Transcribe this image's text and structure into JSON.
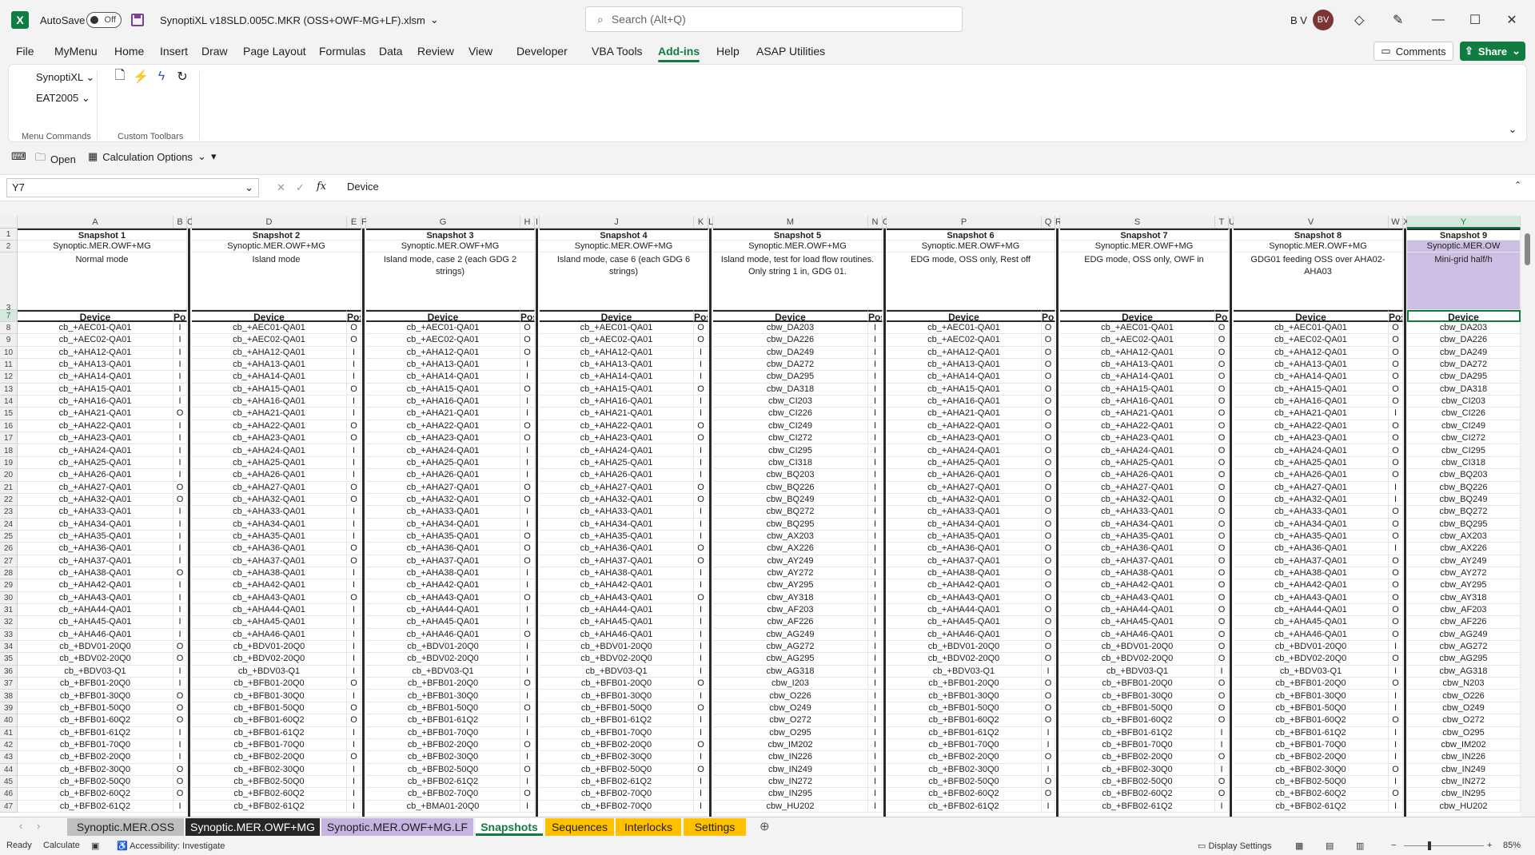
{
  "titlebar": {
    "autosave_label": "AutoSave",
    "autosave_state": "Off",
    "filename": "SynoptiXL v18SLD.005C.MKR (OSS+OWF-MG+LF).xlsm",
    "search_placeholder": "Search (Alt+Q)",
    "user_initials": "B V",
    "avatar_initials": "BV"
  },
  "ribbon_tabs": [
    "File",
    "MyMenu",
    "Home",
    "Insert",
    "Draw",
    "Page Layout",
    "Formulas",
    "Data",
    "Review",
    "View",
    "Developer",
    "VBA Tools",
    "Add-ins",
    "Help",
    "ASAP Utilities"
  ],
  "active_tab": "Add-ins",
  "actions": {
    "comments": "Comments",
    "share": "Share"
  },
  "ribbon": {
    "menu_commands": [
      "SynoptiXL",
      "EAT2005"
    ],
    "group_menu_label": "Menu Commands",
    "group_toolbar_label": "Custom Toolbars"
  },
  "qat": {
    "open": "Open",
    "calc_options": "Calculation Options"
  },
  "formula_bar": {
    "name_box": "Y7",
    "fx": "fx",
    "content": "Device"
  },
  "column_letters": [
    "A",
    "B",
    "C",
    "D",
    "E",
    "F",
    "G",
    "H",
    "I",
    "J",
    "K",
    "L",
    "M",
    "N",
    "O",
    "P",
    "Q",
    "R",
    "S",
    "T",
    "U",
    "V",
    "W",
    "X",
    "Y"
  ],
  "row_numbers": [
    "1",
    "2",
    "3",
    "7",
    "8",
    "9",
    "10",
    "11",
    "12",
    "13",
    "14",
    "15",
    "16",
    "17",
    "18",
    "19",
    "20",
    "21",
    "22",
    "23",
    "24",
    "25",
    "26",
    "27",
    "28",
    "29",
    "30",
    "31",
    "32",
    "33",
    "34",
    "35",
    "36",
    "37",
    "38",
    "39",
    "40",
    "41",
    "42",
    "43",
    "44",
    "45",
    "46",
    "47"
  ],
  "col_header_device": "Device",
  "col_header_pos": "Pos",
  "snapshots": [
    {
      "title": "Snapshot 1",
      "source": "Synoptic.MER.OWF+MG",
      "desc": "Normal mode",
      "devices": [
        "cb_+AEC01-QA01",
        "cb_+AEC02-QA01",
        "cb_+AHA12-QA01",
        "cb_+AHA13-QA01",
        "cb_+AHA14-QA01",
        "cb_+AHA15-QA01",
        "cb_+AHA16-QA01",
        "cb_+AHA21-QA01",
        "cb_+AHA22-QA01",
        "cb_+AHA23-QA01",
        "cb_+AHA24-QA01",
        "cb_+AHA25-QA01",
        "cb_+AHA26-QA01",
        "cb_+AHA27-QA01",
        "cb_+AHA32-QA01",
        "cb_+AHA33-QA01",
        "cb_+AHA34-QA01",
        "cb_+AHA35-QA01",
        "cb_+AHA36-QA01",
        "cb_+AHA37-QA01",
        "cb_+AHA38-QA01",
        "cb_+AHA42-QA01",
        "cb_+AHA43-QA01",
        "cb_+AHA44-QA01",
        "cb_+AHA45-QA01",
        "cb_+AHA46-QA01",
        "cb_+BDV01-20Q0",
        "cb_+BDV02-20Q0",
        "cb_+BDV03-Q1",
        "cb_+BFB01-20Q0",
        "cb_+BFB01-30Q0",
        "cb_+BFB01-50Q0",
        "cb_+BFB01-60Q2",
        "cb_+BFB01-61Q2",
        "cb_+BFB01-70Q0",
        "cb_+BFB02-20Q0",
        "cb_+BFB02-30Q0",
        "cb_+BFB02-50Q0",
        "cb_+BFB02-60Q2",
        "cb_+BFB02-61Q2"
      ],
      "pos": [
        "I",
        "I",
        "I",
        "I",
        "I",
        "I",
        "I",
        "O",
        "I",
        "I",
        "I",
        "I",
        "I",
        "O",
        "O",
        "I",
        "I",
        "I",
        "I",
        "I",
        "O",
        "I",
        "I",
        "I",
        "I",
        "I",
        "O",
        "O",
        "I",
        "I",
        "O",
        "O",
        "O",
        "I",
        "I",
        "I",
        "O",
        "O",
        "O",
        "I"
      ]
    },
    {
      "title": "Snapshot 2",
      "source": "Synoptic.MER.OWF+MG",
      "desc": "Island mode",
      "devices": [
        "cb_+AEC01-QA01",
        "cb_+AEC02-QA01",
        "cb_+AHA12-QA01",
        "cb_+AHA13-QA01",
        "cb_+AHA14-QA01",
        "cb_+AHA15-QA01",
        "cb_+AHA16-QA01",
        "cb_+AHA21-QA01",
        "cb_+AHA22-QA01",
        "cb_+AHA23-QA01",
        "cb_+AHA24-QA01",
        "cb_+AHA25-QA01",
        "cb_+AHA26-QA01",
        "cb_+AHA27-QA01",
        "cb_+AHA32-QA01",
        "cb_+AHA33-QA01",
        "cb_+AHA34-QA01",
        "cb_+AHA35-QA01",
        "cb_+AHA36-QA01",
        "cb_+AHA37-QA01",
        "cb_+AHA38-QA01",
        "cb_+AHA42-QA01",
        "cb_+AHA43-QA01",
        "cb_+AHA44-QA01",
        "cb_+AHA45-QA01",
        "cb_+AHA46-QA01",
        "cb_+BDV01-20Q0",
        "cb_+BDV02-20Q0",
        "cb_+BDV03-Q1",
        "cb_+BFB01-20Q0",
        "cb_+BFB01-30Q0",
        "cb_+BFB01-50Q0",
        "cb_+BFB01-60Q2",
        "cb_+BFB01-61Q2",
        "cb_+BFB01-70Q0",
        "cb_+BFB02-20Q0",
        "cb_+BFB02-30Q0",
        "cb_+BFB02-50Q0",
        "cb_+BFB02-60Q2",
        "cb_+BFB02-61Q2"
      ],
      "pos": [
        "O",
        "O",
        "I",
        "I",
        "I",
        "O",
        "I",
        "I",
        "O",
        "O",
        "I",
        "I",
        "I",
        "O",
        "O",
        "I",
        "I",
        "I",
        "O",
        "O",
        "I",
        "I",
        "O",
        "I",
        "I",
        "I",
        "I",
        "I",
        "I",
        "O",
        "I",
        "O",
        "O",
        "I",
        "I",
        "O",
        "I",
        "I",
        "I",
        "I"
      ]
    },
    {
      "title": "Snapshot 3",
      "source": "Synoptic.MER.OWF+MG",
      "desc": "Island mode, case 2 (each GDG 2 strings)",
      "devices": [
        "cb_+AEC01-QA01",
        "cb_+AEC02-QA01",
        "cb_+AHA12-QA01",
        "cb_+AHA13-QA01",
        "cb_+AHA14-QA01",
        "cb_+AHA15-QA01",
        "cb_+AHA16-QA01",
        "cb_+AHA21-QA01",
        "cb_+AHA22-QA01",
        "cb_+AHA23-QA01",
        "cb_+AHA24-QA01",
        "cb_+AHA25-QA01",
        "cb_+AHA26-QA01",
        "cb_+AHA27-QA01",
        "cb_+AHA32-QA01",
        "cb_+AHA33-QA01",
        "cb_+AHA34-QA01",
        "cb_+AHA35-QA01",
        "cb_+AHA36-QA01",
        "cb_+AHA37-QA01",
        "cb_+AHA38-QA01",
        "cb_+AHA42-QA01",
        "cb_+AHA43-QA01",
        "cb_+AHA44-QA01",
        "cb_+AHA45-QA01",
        "cb_+AHA46-QA01",
        "cb_+BDV01-20Q0",
        "cb_+BDV02-20Q0",
        "cb_+BDV03-Q1",
        "cb_+BFB01-20Q0",
        "cb_+BFB01-30Q0",
        "cb_+BFB01-50Q0",
        "cb_+BFB01-61Q2",
        "cb_+BFB01-70Q0",
        "cb_+BFB02-20Q0",
        "cb_+BFB02-30Q0",
        "cb_+BFB02-50Q0",
        "cb_+BFB02-61Q2",
        "cb_+BFB02-70Q0",
        "cb_+BMA01-20Q0"
      ],
      "pos": [
        "O",
        "O",
        "O",
        "I",
        "I",
        "O",
        "I",
        "I",
        "O",
        "O",
        "I",
        "I",
        "I",
        "O",
        "O",
        "I",
        "I",
        "O",
        "O",
        "O",
        "I",
        "I",
        "O",
        "I",
        "I",
        "O",
        "I",
        "I",
        "I",
        "O",
        "I",
        "O",
        "I",
        "I",
        "O",
        "I",
        "O",
        "I",
        "O",
        "I"
      ]
    },
    {
      "title": "Snapshot 4",
      "source": "Synoptic.MER.OWF+MG",
      "desc": "Island mode, case 6 (each GDG 6 strings)",
      "devices": [
        "cb_+AEC01-QA01",
        "cb_+AEC02-QA01",
        "cb_+AHA12-QA01",
        "cb_+AHA13-QA01",
        "cb_+AHA14-QA01",
        "cb_+AHA15-QA01",
        "cb_+AHA16-QA01",
        "cb_+AHA21-QA01",
        "cb_+AHA22-QA01",
        "cb_+AHA23-QA01",
        "cb_+AHA24-QA01",
        "cb_+AHA25-QA01",
        "cb_+AHA26-QA01",
        "cb_+AHA27-QA01",
        "cb_+AHA32-QA01",
        "cb_+AHA33-QA01",
        "cb_+AHA34-QA01",
        "cb_+AHA35-QA01",
        "cb_+AHA36-QA01",
        "cb_+AHA37-QA01",
        "cb_+AHA38-QA01",
        "cb_+AHA42-QA01",
        "cb_+AHA43-QA01",
        "cb_+AHA44-QA01",
        "cb_+AHA45-QA01",
        "cb_+AHA46-QA01",
        "cb_+BDV01-20Q0",
        "cb_+BDV02-20Q0",
        "cb_+BDV03-Q1",
        "cb_+BFB01-20Q0",
        "cb_+BFB01-30Q0",
        "cb_+BFB01-50Q0",
        "cb_+BFB01-61Q2",
        "cb_+BFB01-70Q0",
        "cb_+BFB02-20Q0",
        "cb_+BFB02-30Q0",
        "cb_+BFB02-50Q0",
        "cb_+BFB02-61Q2",
        "cb_+BFB02-70Q0",
        "cb_+BFB02-70Q0"
      ],
      "pos": [
        "O",
        "O",
        "I",
        "I",
        "I",
        "O",
        "I",
        "I",
        "O",
        "O",
        "I",
        "I",
        "I",
        "O",
        "O",
        "I",
        "I",
        "I",
        "O",
        "O",
        "I",
        "I",
        "O",
        "I",
        "I",
        "I",
        "I",
        "I",
        "I",
        "O",
        "I",
        "O",
        "I",
        "I",
        "O",
        "I",
        "O",
        "I",
        "I",
        "I"
      ]
    },
    {
      "title": "Snapshot 5",
      "source": "Synoptic.MER.OWF+MG",
      "desc": "Island mode, test for load flow routines. Only string 1 in, GDG 01.",
      "devices": [
        "cbw_DA203",
        "cbw_DA226",
        "cbw_DA249",
        "cbw_DA272",
        "cbw_DA295",
        "cbw_DA318",
        "cbw_CI203",
        "cbw_CI226",
        "cbw_CI249",
        "cbw_CI272",
        "cbw_CI295",
        "cbw_CI318",
        "cbw_BQ203",
        "cbw_BQ226",
        "cbw_BQ249",
        "cbw_BQ272",
        "cbw_BQ295",
        "cbw_AX203",
        "cbw_AX226",
        "cbw_AY249",
        "cbw_AY272",
        "cbw_AY295",
        "cbw_AY318",
        "cbw_AF203",
        "cbw_AF226",
        "cbw_AG249",
        "cbw_AG272",
        "cbw_AG295",
        "cbw_AG318",
        "cbw_I203",
        "cbw_O226",
        "cbw_O249",
        "cbw_O272",
        "cbw_O295",
        "cbw_IM202",
        "cbw_IN226",
        "cbw_IN249",
        "cbw_IN272",
        "cbw_IN295",
        "cbw_HU202"
      ],
      "pos": [
        "I",
        "I",
        "I",
        "I",
        "I",
        "I",
        "I",
        "I",
        "I",
        "I",
        "I",
        "I",
        "I",
        "I",
        "I",
        "I",
        "I",
        "I",
        "I",
        "I",
        "I",
        "I",
        "I",
        "I",
        "I",
        "I",
        "I",
        "I",
        "I",
        "I",
        "I",
        "I",
        "I",
        "I",
        "I",
        "I",
        "I",
        "I",
        "I",
        "I"
      ]
    },
    {
      "title": "Snapshot 6",
      "source": "Synoptic.MER.OWF+MG",
      "desc": "EDG mode, OSS only, Rest off",
      "devices": [
        "cb_+AEC01-QA01",
        "cb_+AEC02-QA01",
        "cb_+AHA12-QA01",
        "cb_+AHA13-QA01",
        "cb_+AHA14-QA01",
        "cb_+AHA15-QA01",
        "cb_+AHA16-QA01",
        "cb_+AHA21-QA01",
        "cb_+AHA22-QA01",
        "cb_+AHA23-QA01",
        "cb_+AHA24-QA01",
        "cb_+AHA25-QA01",
        "cb_+AHA26-QA01",
        "cb_+AHA27-QA01",
        "cb_+AHA32-QA01",
        "cb_+AHA33-QA01",
        "cb_+AHA34-QA01",
        "cb_+AHA35-QA01",
        "cb_+AHA36-QA01",
        "cb_+AHA37-QA01",
        "cb_+AHA38-QA01",
        "cb_+AHA42-QA01",
        "cb_+AHA43-QA01",
        "cb_+AHA44-QA01",
        "cb_+AHA45-QA01",
        "cb_+AHA46-QA01",
        "cb_+BDV01-20Q0",
        "cb_+BDV02-20Q0",
        "cb_+BDV03-Q1",
        "cb_+BFB01-20Q0",
        "cb_+BFB01-30Q0",
        "cb_+BFB01-50Q0",
        "cb_+BFB01-60Q2",
        "cb_+BFB01-61Q2",
        "cb_+BFB01-70Q0",
        "cb_+BFB02-20Q0",
        "cb_+BFB02-30Q0",
        "cb_+BFB02-50Q0",
        "cb_+BFB02-60Q2",
        "cb_+BFB02-61Q2"
      ],
      "pos": [
        "O",
        "O",
        "O",
        "O",
        "O",
        "O",
        "O",
        "O",
        "O",
        "O",
        "O",
        "O",
        "O",
        "O",
        "O",
        "O",
        "O",
        "O",
        "O",
        "O",
        "O",
        "O",
        "O",
        "O",
        "O",
        "O",
        "O",
        "O",
        "I",
        "O",
        "O",
        "O",
        "O",
        "I",
        "I",
        "O",
        "I",
        "O",
        "O",
        "I"
      ]
    },
    {
      "title": "Snapshot 7",
      "source": "Synoptic.MER.OWF+MG",
      "desc": "EDG mode, OSS only, OWF in",
      "devices": [
        "cb_+AEC01-QA01",
        "cb_+AEC02-QA01",
        "cb_+AHA12-QA01",
        "cb_+AHA13-QA01",
        "cb_+AHA14-QA01",
        "cb_+AHA15-QA01",
        "cb_+AHA16-QA01",
        "cb_+AHA21-QA01",
        "cb_+AHA22-QA01",
        "cb_+AHA23-QA01",
        "cb_+AHA24-QA01",
        "cb_+AHA25-QA01",
        "cb_+AHA26-QA01",
        "cb_+AHA27-QA01",
        "cb_+AHA32-QA01",
        "cb_+AHA33-QA01",
        "cb_+AHA34-QA01",
        "cb_+AHA35-QA01",
        "cb_+AHA36-QA01",
        "cb_+AHA37-QA01",
        "cb_+AHA38-QA01",
        "cb_+AHA42-QA01",
        "cb_+AHA43-QA01",
        "cb_+AHA44-QA01",
        "cb_+AHA45-QA01",
        "cb_+AHA46-QA01",
        "cb_+BDV01-20Q0",
        "cb_+BDV02-20Q0",
        "cb_+BDV03-Q1",
        "cb_+BFB01-20Q0",
        "cb_+BFB01-30Q0",
        "cb_+BFB01-50Q0",
        "cb_+BFB01-60Q2",
        "cb_+BFB01-61Q2",
        "cb_+BFB01-70Q0",
        "cb_+BFB02-20Q0",
        "cb_+BFB02-30Q0",
        "cb_+BFB02-50Q0",
        "cb_+BFB02-60Q2",
        "cb_+BFB02-61Q2"
      ],
      "pos": [
        "O",
        "O",
        "O",
        "O",
        "O",
        "O",
        "O",
        "O",
        "O",
        "O",
        "O",
        "O",
        "O",
        "O",
        "O",
        "O",
        "O",
        "O",
        "O",
        "O",
        "O",
        "O",
        "O",
        "O",
        "O",
        "O",
        "O",
        "O",
        "I",
        "O",
        "O",
        "O",
        "O",
        "I",
        "I",
        "O",
        "I",
        "O",
        "O",
        "I"
      ]
    },
    {
      "title": "Snapshot 8",
      "source": "Synoptic.MER.OWF+MG",
      "desc": "GDG01 feeding OSS over AHA02-AHA03",
      "devices": [
        "cb_+AEC01-QA01",
        "cb_+AEC02-QA01",
        "cb_+AHA12-QA01",
        "cb_+AHA13-QA01",
        "cb_+AHA14-QA01",
        "cb_+AHA15-QA01",
        "cb_+AHA16-QA01",
        "cb_+AHA21-QA01",
        "cb_+AHA22-QA01",
        "cb_+AHA23-QA01",
        "cb_+AHA24-QA01",
        "cb_+AHA25-QA01",
        "cb_+AHA26-QA01",
        "cb_+AHA27-QA01",
        "cb_+AHA32-QA01",
        "cb_+AHA33-QA01",
        "cb_+AHA34-QA01",
        "cb_+AHA35-QA01",
        "cb_+AHA36-QA01",
        "cb_+AHA37-QA01",
        "cb_+AHA38-QA01",
        "cb_+AHA42-QA01",
        "cb_+AHA43-QA01",
        "cb_+AHA44-QA01",
        "cb_+AHA45-QA01",
        "cb_+AHA46-QA01",
        "cb_+BDV01-20Q0",
        "cb_+BDV02-20Q0",
        "cb_+BDV03-Q1",
        "cb_+BFB01-20Q0",
        "cb_+BFB01-30Q0",
        "cb_+BFB01-50Q0",
        "cb_+BFB01-60Q2",
        "cb_+BFB01-61Q2",
        "cb_+BFB01-70Q0",
        "cb_+BFB02-20Q0",
        "cb_+BFB02-30Q0",
        "cb_+BFB02-50Q0",
        "cb_+BFB02-60Q2",
        "cb_+BFB02-61Q2"
      ],
      "pos": [
        "O",
        "O",
        "O",
        "O",
        "O",
        "O",
        "O",
        "I",
        "O",
        "O",
        "O",
        "O",
        "O",
        "I",
        "I",
        "O",
        "O",
        "O",
        "I",
        "O",
        "O",
        "O",
        "O",
        "O",
        "O",
        "O",
        "I",
        "O",
        "I",
        "O",
        "I",
        "I",
        "O",
        "I",
        "I",
        "I",
        "O",
        "I",
        "O",
        "I"
      ]
    },
    {
      "title": "Snapshot 9",
      "source": "Synoptic.MER.OW",
      "desc": "Mini-grid half/h",
      "devices": [
        "cbw_DA203",
        "cbw_DA226",
        "cbw_DA249",
        "cbw_DA272",
        "cbw_DA295",
        "cbw_DA318",
        "cbw_CI203",
        "cbw_CI226",
        "cbw_CI249",
        "cbw_CI272",
        "cbw_CI295",
        "cbw_CI318",
        "cbw_BQ203",
        "cbw_BQ226",
        "cbw_BQ249",
        "cbw_BQ272",
        "cbw_BQ295",
        "cbw_AX203",
        "cbw_AX226",
        "cbw_AY249",
        "cbw_AY272",
        "cbw_AY295",
        "cbw_AY318",
        "cbw_AF203",
        "cbw_AF226",
        "cbw_AG249",
        "cbw_AG272",
        "cbw_AG295",
        "cbw_AG318",
        "cbw_N203",
        "cbw_O226",
        "cbw_O249",
        "cbw_O272",
        "cbw_O295",
        "cbw_IM202",
        "cbw_IN226",
        "cbw_IN249",
        "cbw_IN272",
        "cbw_IN295",
        "cbw_HU202"
      ],
      "pos": []
    }
  ],
  "sheet_tabs": [
    {
      "label": "Synoptic.MER.OSS",
      "bg": "#bfbfbf",
      "fg": "#1f1f1f"
    },
    {
      "label": "Synoptic.MER.OWF+MG",
      "bg": "#262626",
      "fg": "#ffffff"
    },
    {
      "label": "Synoptic.MER.OWF+MG.LF",
      "bg": "#c5b3e0",
      "fg": "#1f1f1f"
    },
    {
      "label": "Snapshots",
      "bg": "#ffffff",
      "fg": "#107c41"
    },
    {
      "label": "Sequences",
      "bg": "#ffc000",
      "fg": "#1f1f1f"
    },
    {
      "label": "Interlocks",
      "bg": "#ffc000",
      "fg": "#1f1f1f"
    },
    {
      "label": "Settings",
      "bg": "#ffc000",
      "fg": "#1f1f1f"
    }
  ],
  "status": {
    "ready": "Ready",
    "calculate": "Calculate",
    "accessibility": "Accessibility: Investigate",
    "display_settings": "Display Settings",
    "zoom": "85%"
  }
}
